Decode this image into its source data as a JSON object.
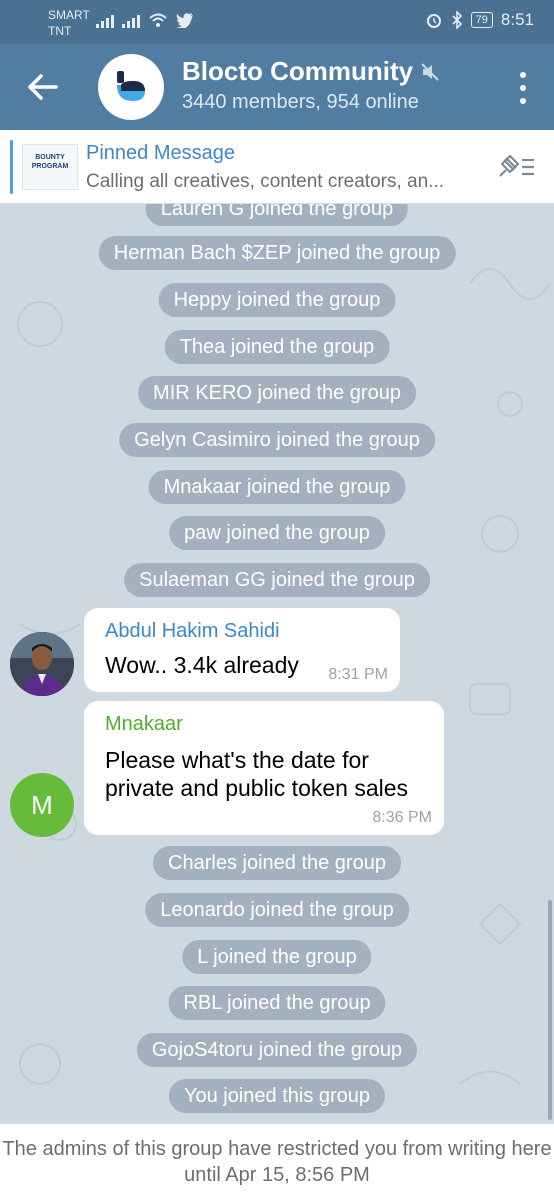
{
  "status_bar": {
    "carrier_line1": "SMART",
    "carrier_line2": "TNT",
    "battery": "79",
    "time": "8:51",
    "icons": [
      "signal-icon",
      "signal-icon",
      "wifi-icon",
      "twitter-icon",
      "alarm-icon",
      "bluetooth-icon",
      "battery-icon"
    ]
  },
  "header": {
    "title": "Blocto Community",
    "subtitle": "3440 members, 954 online",
    "muted_icon": "muted-icon"
  },
  "pinned": {
    "title": "Pinned Message",
    "body": "Calling all creatives, content creators, an...",
    "thumb_line1": "BOUNTY",
    "thumb_line2": "PROGRAM"
  },
  "messages": {
    "service": [
      "Lauren G joined the group",
      "Herman Bach $ZEP joined the group",
      "Heppy joined the group",
      "Thea joined the group",
      "MIR KERO joined the group",
      "Gelyn Casimiro joined the group",
      "Mnakaar joined the group",
      "paw joined the group",
      "Sulaeman GG joined the group",
      "Charles joined the group",
      "Leonardo joined the group",
      "L joined the group",
      "RBL joined the group",
      "GojoS4toru joined the group",
      "You joined this group"
    ],
    "chat": [
      {
        "sender": "Abdul Hakim Sahidi",
        "sender_color": "#3d88c5",
        "text": "Wow.. 3.4k already",
        "time": "8:31 PM"
      },
      {
        "sender": "Mnakaar",
        "sender_color": "#4fae33",
        "avatar_letter": "M",
        "avatar_color": "#66bb3a",
        "text": "Please what's the date for private and public token sales",
        "time": "8:36 PM"
      }
    ]
  },
  "footer": {
    "notice": "The admins of this group have restricted you from writing here until Apr 15, 8:56 PM"
  },
  "colors": {
    "header": "#517da2",
    "status_bar": "#4a7092",
    "chat_background": "#cdd8e0",
    "accent": "#3d88c5"
  }
}
